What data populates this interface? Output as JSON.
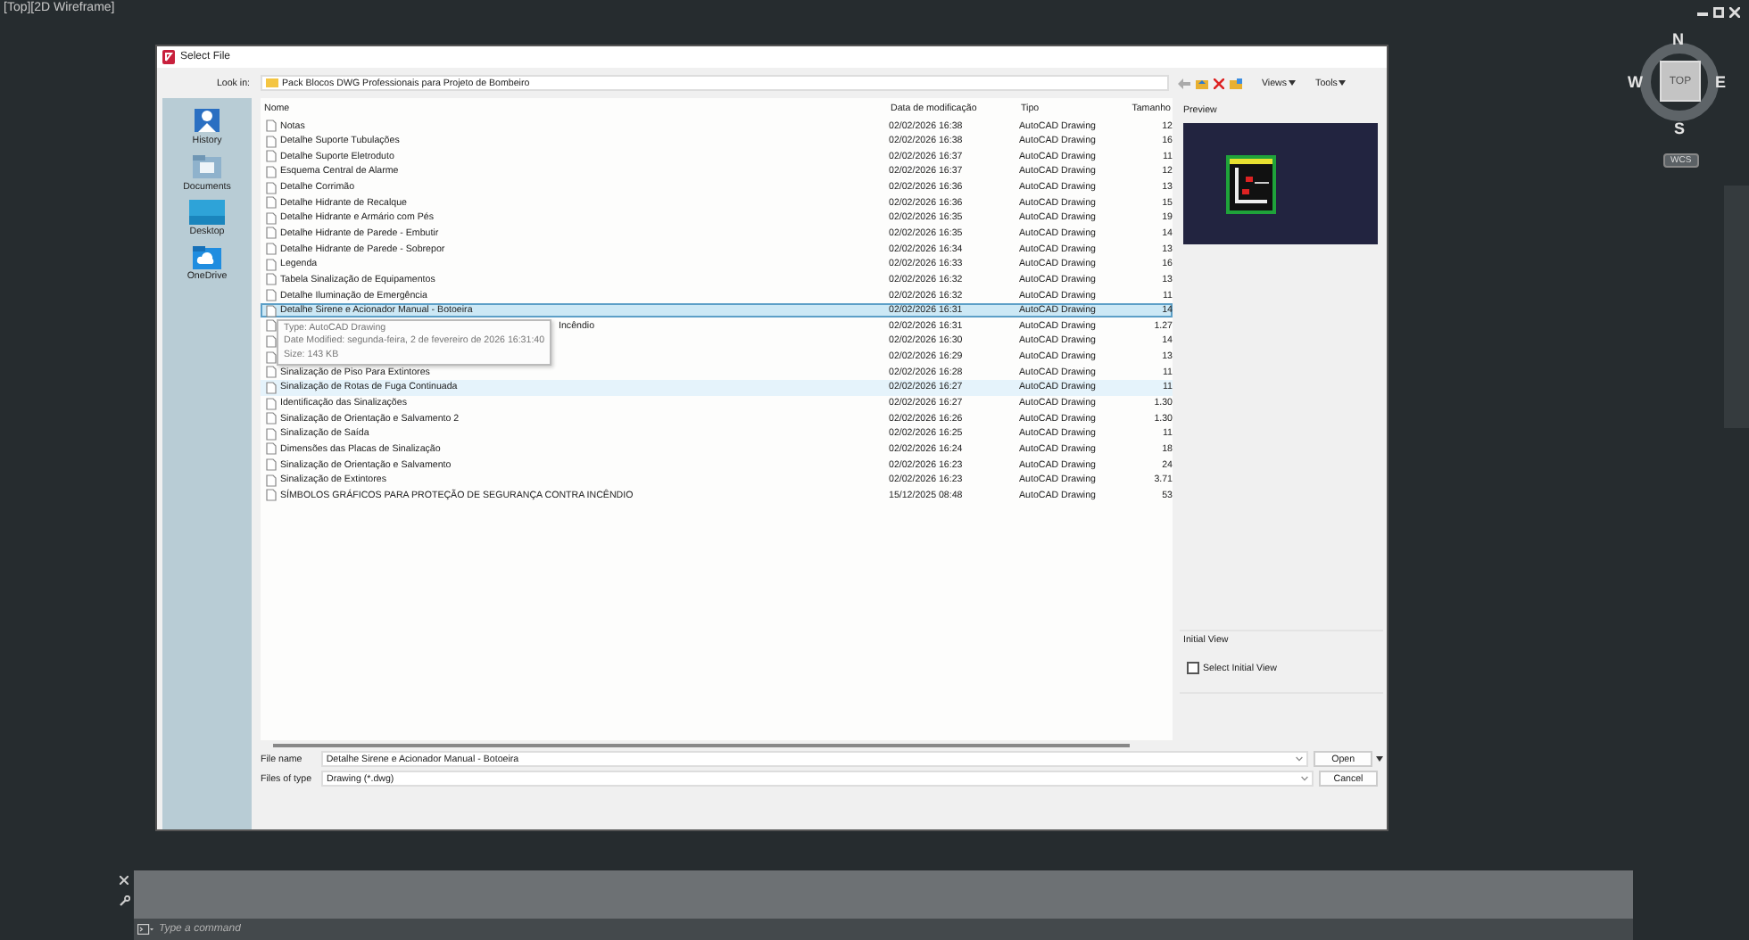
{
  "viewport": {
    "label": "[Top][2D Wireframe]"
  },
  "viewcube": {
    "face": "TOP",
    "north": "N",
    "south": "S",
    "east": "E",
    "west": "W",
    "ucs": "WCS"
  },
  "dialog": {
    "title": "Select File",
    "look_in_label": "Look in:",
    "look_in": "Pack Blocos DWG Professionais para Projeto de Bombeiro",
    "toolbar": {
      "views": "Views",
      "tools": "Tools"
    },
    "places": [
      {
        "label": "History",
        "kind": "history"
      },
      {
        "label": "Documents",
        "kind": "documents"
      },
      {
        "label": "Desktop",
        "kind": "desktop"
      },
      {
        "label": "OneDrive",
        "kind": "cloud"
      }
    ],
    "columns": [
      "Nome",
      "Data de modificação",
      "Tipo",
      "Tamanho"
    ],
    "files": [
      {
        "name": "Notas",
        "date": "02/02/2026 16:38",
        "type": "AutoCAD Drawing",
        "size": "12",
        "selected": false,
        "hovered": false
      },
      {
        "name": "Detalhe Suporte Tubulações",
        "date": "02/02/2026 16:38",
        "type": "AutoCAD Drawing",
        "size": "16",
        "selected": false,
        "hovered": false
      },
      {
        "name": "Detalhe Suporte Eletroduto",
        "date": "02/02/2026 16:37",
        "type": "AutoCAD Drawing",
        "size": "11",
        "selected": false,
        "hovered": false
      },
      {
        "name": "Esquema Central de Alarme",
        "date": "02/02/2026 16:37",
        "type": "AutoCAD Drawing",
        "size": "12",
        "selected": false,
        "hovered": false
      },
      {
        "name": "Detalhe Corrimão",
        "date": "02/02/2026 16:36",
        "type": "AutoCAD Drawing",
        "size": "13",
        "selected": false,
        "hovered": false
      },
      {
        "name": "Detalhe Hidrante de Recalque",
        "date": "02/02/2026 16:36",
        "type": "AutoCAD Drawing",
        "size": "15",
        "selected": false,
        "hovered": false
      },
      {
        "name": "Detalhe Hidrante e Armário com Pés",
        "date": "02/02/2026 16:35",
        "type": "AutoCAD Drawing",
        "size": "19",
        "selected": false,
        "hovered": false
      },
      {
        "name": "Detalhe Hidrante de Parede - Embutir",
        "date": "02/02/2026 16:35",
        "type": "AutoCAD Drawing",
        "size": "14",
        "selected": false,
        "hovered": false
      },
      {
        "name": "Detalhe Hidrante de Parede - Sobrepor",
        "date": "02/02/2026 16:34",
        "type": "AutoCAD Drawing",
        "size": "13",
        "selected": false,
        "hovered": false
      },
      {
        "name": "Legenda",
        "date": "02/02/2026 16:33",
        "type": "AutoCAD Drawing",
        "size": "16",
        "selected": false,
        "hovered": false
      },
      {
        "name": "Tabela Sinalização de Equipamentos",
        "date": "02/02/2026 16:32",
        "type": "AutoCAD Drawing",
        "size": "13",
        "selected": false,
        "hovered": false
      },
      {
        "name": "Detalhe Iluminação de Emergência",
        "date": "02/02/2026 16:32",
        "type": "AutoCAD Drawing",
        "size": "11",
        "selected": false,
        "hovered": false
      },
      {
        "name": "Detalhe Sirene e Acionador Manual - Botoeira",
        "date": "02/02/2026 16:31",
        "type": "AutoCAD Drawing",
        "size": "14",
        "selected": true,
        "hovered": false
      },
      {
        "name": "Incêndio",
        "covered": true,
        "date": "02/02/2026 16:31",
        "type": "AutoCAD Drawing",
        "size": "1.27",
        "selected": false,
        "hovered": false
      },
      {
        "covered": true,
        "date": "02/02/2026 16:30",
        "type": "AutoCAD Drawing",
        "size": "14",
        "selected": false,
        "hovered": false
      },
      {
        "covered": true,
        "date": "02/02/2026 16:29",
        "type": "AutoCAD Drawing",
        "size": "13",
        "selected": false,
        "hovered": false
      },
      {
        "name": "Sinalização de Piso Para Extintores",
        "date": "02/02/2026 16:28",
        "type": "AutoCAD Drawing",
        "size": "11",
        "selected": false,
        "hovered": false
      },
      {
        "name": "Sinalização de Rotas de Fuga Continuada",
        "date": "02/02/2026 16:27",
        "type": "AutoCAD Drawing",
        "size": "11",
        "selected": false,
        "hovered": true
      },
      {
        "name": "Identificação das Sinalizações",
        "date": "02/02/2026 16:27",
        "type": "AutoCAD Drawing",
        "size": "1.30",
        "selected": false,
        "hovered": false
      },
      {
        "name": "Sinalização de Orientação e Salvamento 2",
        "date": "02/02/2026 16:26",
        "type": "AutoCAD Drawing",
        "size": "1.30",
        "selected": false,
        "hovered": false
      },
      {
        "name": "Sinalização de Saída",
        "date": "02/02/2026 16:25",
        "type": "AutoCAD Drawing",
        "size": "11",
        "selected": false,
        "hovered": false
      },
      {
        "name": "Dimensões das Placas de Sinalização",
        "date": "02/02/2026 16:24",
        "type": "AutoCAD Drawing",
        "size": "18",
        "selected": false,
        "hovered": false
      },
      {
        "name": "Sinalização de Orientação e Salvamento",
        "date": "02/02/2026 16:23",
        "type": "AutoCAD Drawing",
        "size": "24",
        "selected": false,
        "hovered": false
      },
      {
        "name": "Sinalização de Extintores",
        "date": "02/02/2026 16:23",
        "type": "AutoCAD Drawing",
        "size": "3.71",
        "selected": false,
        "hovered": false
      },
      {
        "name": "SÍMBOLOS GRÁFICOS PARA PROTEÇÃO DE SEGURANÇA CONTRA INCÊNDIO",
        "date": "15/12/2025 08:48",
        "type": "AutoCAD Drawing",
        "size": "53",
        "selected": false,
        "hovered": false
      }
    ],
    "tooltip": {
      "lines": [
        "Type: AutoCAD Drawing",
        "Date Modified: segunda-feira, 2 de fevereiro de 2026 16:31:40",
        "Size: 143 KB"
      ]
    },
    "preview_label": "Preview",
    "initial_view": {
      "label": "Initial View",
      "checkbox": "Select Initial View",
      "checked": false
    },
    "file_name_label": "File name",
    "file_name": "Detalhe Sirene e Acionador Manual - Botoeira",
    "files_of_type_label": "Files of type",
    "file_type": "Drawing (*.dwg)",
    "open": "Open",
    "cancel": "Cancel"
  },
  "command_line": {
    "placeholder": "Type a command"
  }
}
